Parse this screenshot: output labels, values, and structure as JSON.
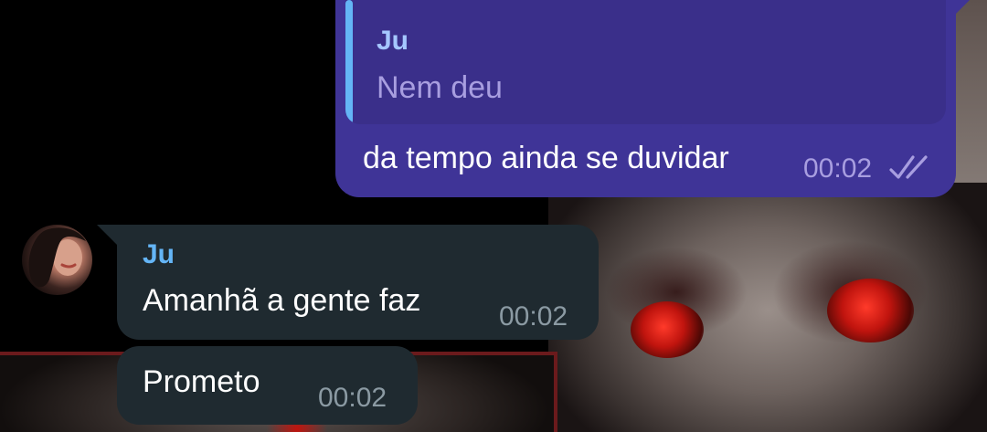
{
  "wallpaper": {
    "description_icon": "cat-wallpaper"
  },
  "messages": {
    "outgoing": {
      "reply_to": {
        "sender": "Ju",
        "text": "Nem deu"
      },
      "text": "da tempo ainda se duvidar",
      "time": "00:02",
      "status_icon": "double-check-icon",
      "bubble_color": "#3f3497"
    },
    "incoming": {
      "sender": "Ju",
      "avatar_icon": "avatar",
      "bubble_color": "#1f2a30",
      "items": [
        {
          "text": "Amanhã a gente faz",
          "time": "00:02"
        },
        {
          "text": "Prometo",
          "time": "00:02"
        }
      ]
    }
  },
  "colors": {
    "accent_name_in": "#64b5f6",
    "accent_reply_bar": "#64b5f6"
  }
}
